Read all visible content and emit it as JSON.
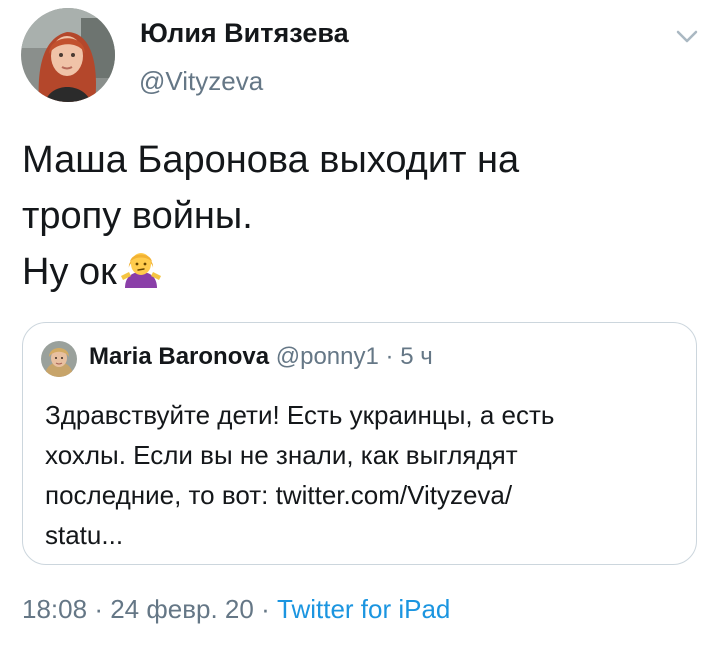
{
  "author": {
    "display_name": "Юлия Витязева",
    "handle": "@Vityzeva"
  },
  "tweet": {
    "lines": [
      "Маша Баронова выходит на",
      "тропу войны.",
      "Ну ок"
    ],
    "emoji": "person-shrugging-emoji"
  },
  "quoted_tweet": {
    "display_name": "Maria Baronova",
    "handle": "@ponny1",
    "separator": "·",
    "time": "5 ч",
    "lines": [
      "Здравствуйте дети! Есть украинцы, а есть",
      "хохлы. Если вы не знали, как выглядят",
      "последние, то вот: twitter.com/Vityzeva/",
      "statu..."
    ]
  },
  "meta": {
    "time": "18:08",
    "sep1": "·",
    "date": "24 февр. 20",
    "sep2": "·",
    "source": "Twitter for iPad"
  },
  "colors": {
    "text": "#14171a",
    "secondary": "#657786",
    "link": "#1b95e0",
    "border": "#ccd6dd"
  },
  "icons": {
    "caret": "chevron-down-icon"
  }
}
